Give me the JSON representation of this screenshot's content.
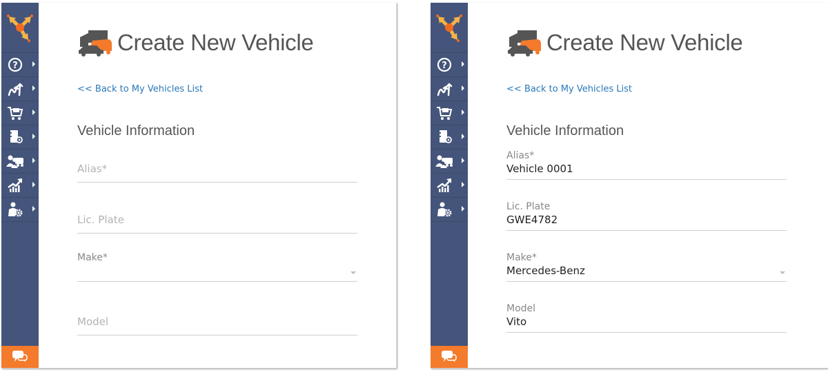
{
  "panels": [
    {
      "title": "Create New Vehicle",
      "back_link": "<< Back to My Vehicles List",
      "section_title": "Vehicle Information",
      "fields": {
        "alias": {
          "label": "Alias*",
          "value": ""
        },
        "plate": {
          "label": "Lic. Plate",
          "value": ""
        },
        "make": {
          "label": "Make*",
          "value": ""
        },
        "model": {
          "label": "Model",
          "value": ""
        }
      }
    },
    {
      "title": "Create New Vehicle",
      "back_link": "<< Back to My Vehicles List",
      "section_title": "Vehicle Information",
      "fields": {
        "alias": {
          "label": "Alias*",
          "value": "Vehicle 0001"
        },
        "plate": {
          "label": "Lic. Plate",
          "value": "GWE4782"
        },
        "make": {
          "label": "Make*",
          "value": "Mercedes-Benz"
        },
        "model": {
          "label": "Model",
          "value": "Vito"
        }
      }
    }
  ],
  "sidebar": {
    "items": [
      {
        "icon": "help-icon"
      },
      {
        "icon": "routes-icon"
      },
      {
        "icon": "cart-icon"
      },
      {
        "icon": "address-book-icon"
      },
      {
        "icon": "team-vehicle-icon"
      },
      {
        "icon": "analytics-icon"
      },
      {
        "icon": "user-settings-icon"
      }
    ],
    "chat_icon": "chat-icon"
  },
  "colors": {
    "sidebar": "#44547a",
    "accent": "#f47a2c",
    "link": "#2a78b8"
  }
}
